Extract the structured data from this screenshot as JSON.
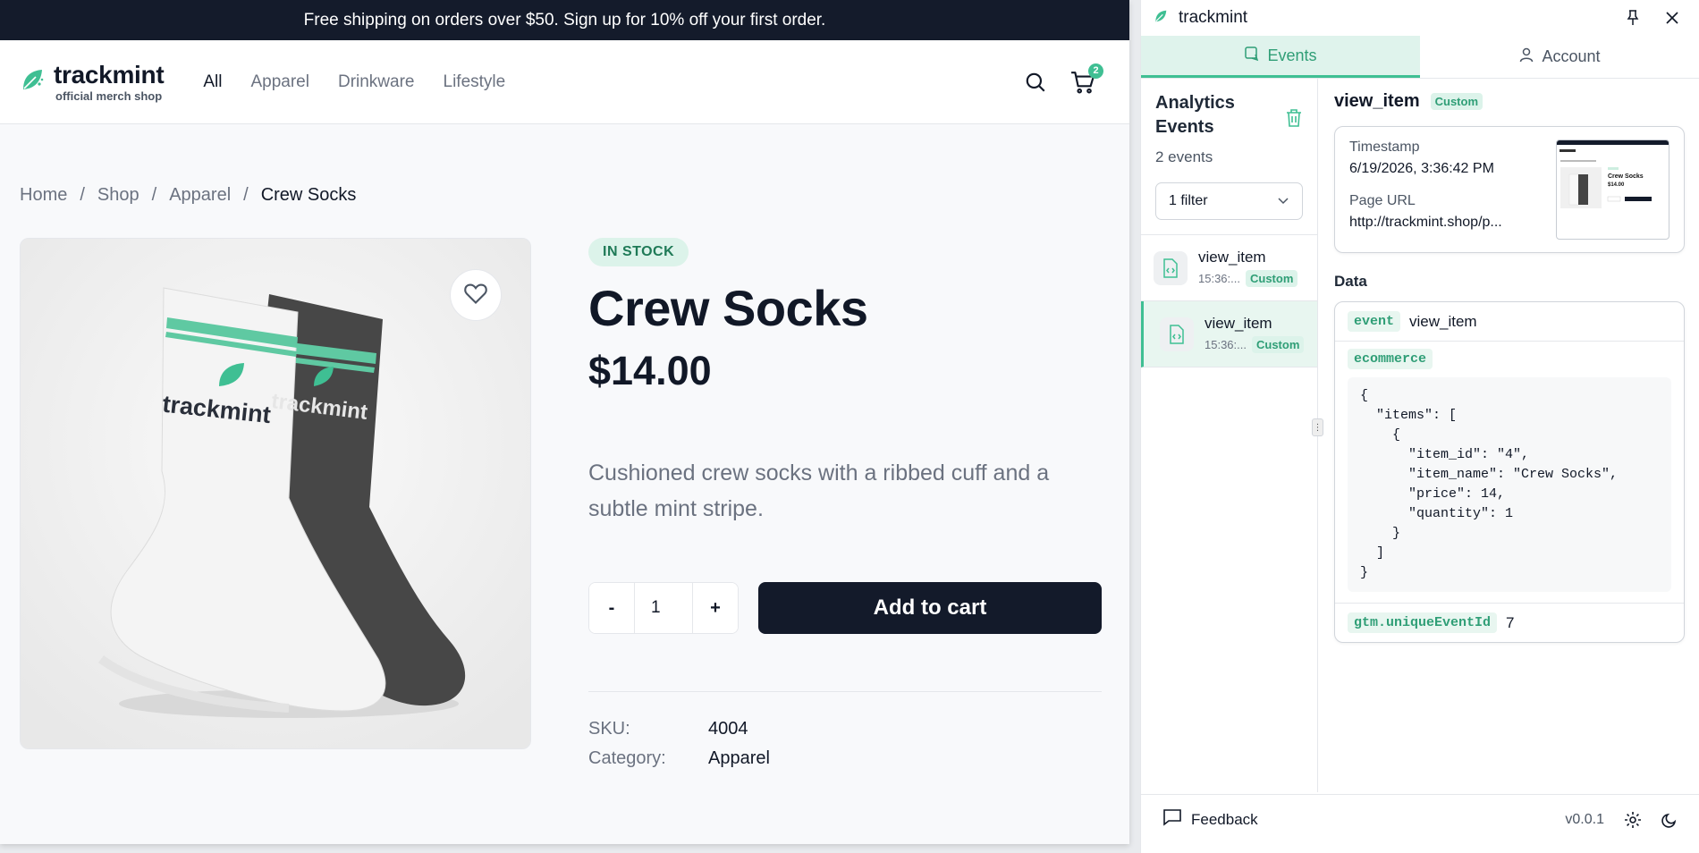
{
  "announcement": "Free shipping on orders over $50. Sign up for 10% off your first order.",
  "brand": {
    "name": "trackmint",
    "tagline": "official merch shop"
  },
  "nav": [
    {
      "label": "All"
    },
    {
      "label": "Apparel"
    },
    {
      "label": "Drinkware"
    },
    {
      "label": "Lifestyle"
    }
  ],
  "cart": {
    "count": "2"
  },
  "breadcrumb": [
    "Home",
    "Shop",
    "Apparel",
    "Crew Socks"
  ],
  "product": {
    "stock": "IN STOCK",
    "title": "Crew Socks",
    "price": "$14.00",
    "description": "Cushioned crew socks with a ribbed cuff and a subtle mint stripe.",
    "image_label_left": "trackmint",
    "image_label_right": "trackmint",
    "quantity": "1",
    "minus": "-",
    "plus": "+",
    "add_to_cart": "Add to cart",
    "meta": [
      {
        "key": "SKU:",
        "value": "4004"
      },
      {
        "key": "Category:",
        "value": "Apparel"
      }
    ]
  },
  "panel": {
    "title": "trackmint",
    "tabs": [
      {
        "label": "Events"
      },
      {
        "label": "Account"
      }
    ],
    "list_title": "Analytics Events",
    "count": "2 events",
    "filter": "1 filter",
    "events": [
      {
        "name": "view_item",
        "time": "15:36:...",
        "tag": "Custom"
      },
      {
        "name": "view_item",
        "time": "15:36:...",
        "tag": "Custom"
      }
    ],
    "detail": {
      "name": "view_item",
      "tag": "Custom",
      "timestamp_label": "Timestamp",
      "timestamp": "6/19/2026, 3:36:42 PM",
      "url_label": "Page URL",
      "url": "http://trackmint.shop/p...",
      "thumb_title": "Crew Socks",
      "thumb_price": "$14.00",
      "data_label": "Data",
      "event_key": "event",
      "event_value": "view_item",
      "ecommerce_key": "ecommerce",
      "ecommerce_json": "{\n  \"items\": [\n    {\n      \"item_id\": \"4\",\n      \"item_name\": \"Crew Socks\",\n      \"price\": 14,\n      \"quantity\": 1\n    }\n  ]\n}",
      "unique_key": "gtm.uniqueEventId",
      "unique_value": "7"
    },
    "feedback": "Feedback",
    "version": "v0.0.1"
  },
  "colors": {
    "accent": "#3fbf93",
    "dark": "#131a2a",
    "announce_bg": "#141b2b"
  }
}
